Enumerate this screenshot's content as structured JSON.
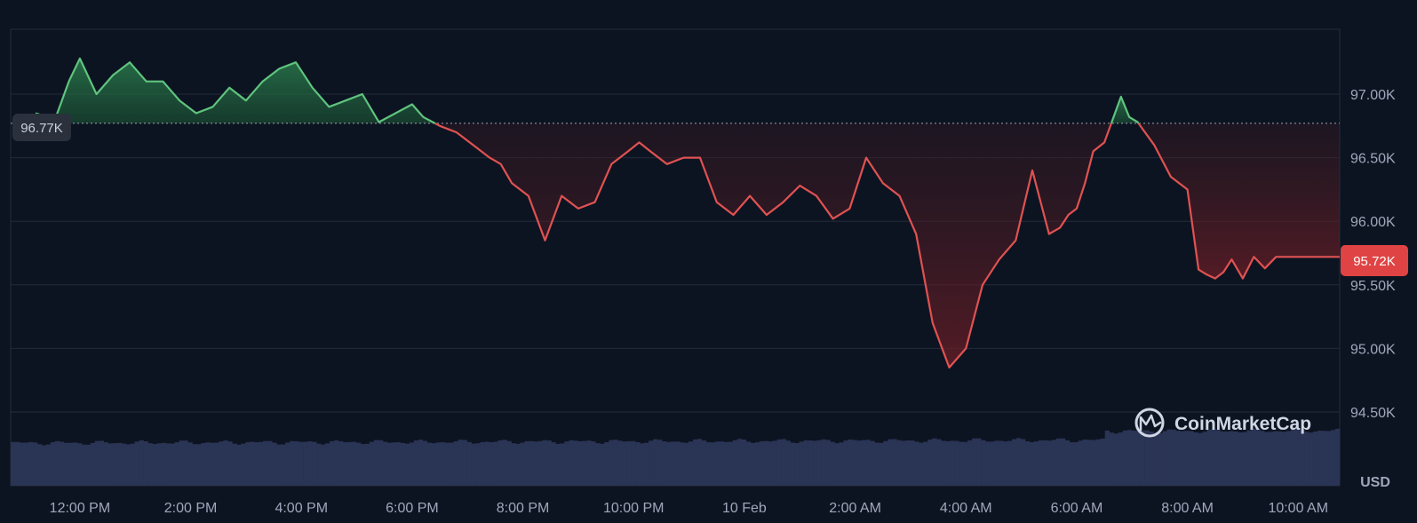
{
  "chart_data": {
    "type": "area",
    "currency_label": "USD",
    "reference_label": "96.77K",
    "reference_value": 96.77,
    "current_label": "95.72K",
    "current_value": 95.72,
    "ylim": [
      94.0,
      97.5
    ],
    "y_ticks": [
      {
        "value": 97.0,
        "label": "97.00K"
      },
      {
        "value": 96.5,
        "label": "96.50K"
      },
      {
        "value": 96.0,
        "label": "96.00K"
      },
      {
        "value": 95.5,
        "label": "95.50K"
      },
      {
        "value": 95.0,
        "label": "95.00K"
      },
      {
        "value": 94.5,
        "label": "94.50K"
      }
    ],
    "x_range": [
      10.75,
      34.75
    ],
    "x_ticks": [
      {
        "value": 12,
        "label": "12:00 PM"
      },
      {
        "value": 14,
        "label": "2:00 PM"
      },
      {
        "value": 16,
        "label": "4:00 PM"
      },
      {
        "value": 18,
        "label": "6:00 PM"
      },
      {
        "value": 20,
        "label": "8:00 PM"
      },
      {
        "value": 22,
        "label": "10:00 PM"
      },
      {
        "value": 24,
        "label": "10 Feb"
      },
      {
        "value": 26,
        "label": "2:00 AM"
      },
      {
        "value": 28,
        "label": "4:00 AM"
      },
      {
        "value": 30,
        "label": "6:00 AM"
      },
      {
        "value": 32,
        "label": "8:00 AM"
      },
      {
        "value": 34,
        "label": "10:00 AM"
      }
    ],
    "colors": {
      "up": "#16c784",
      "down": "#ea3943",
      "line_up": "#5fc47e",
      "line_down": "#e05252",
      "volume": "#2a3455"
    },
    "series": [
      {
        "x": [
          11.2,
          11.55,
          11.8,
          12.0,
          12.3,
          12.6,
          12.9,
          13.2,
          13.5,
          13.8,
          14.1,
          14.4,
          14.7,
          15.0,
          15.3,
          15.6,
          15.9,
          16.2,
          16.5,
          16.8,
          17.1,
          17.4,
          17.7,
          18.0,
          18.2,
          18.5,
          18.8,
          19.1,
          19.4,
          19.6,
          19.8,
          20.1,
          20.4,
          20.7,
          21.0,
          21.3,
          21.6,
          21.9,
          22.1,
          22.3,
          22.6,
          22.9,
          23.2,
          23.5,
          23.8,
          24.1,
          24.4,
          24.7,
          25.0,
          25.3,
          25.6,
          25.9,
          26.2,
          26.5,
          26.8,
          27.1,
          27.4,
          27.7,
          28.0,
          28.3,
          28.6,
          28.9,
          29.2,
          29.5,
          29.7,
          29.85,
          30.0,
          30.15,
          30.3,
          30.5,
          30.8,
          30.95,
          31.1,
          31.4,
          31.7,
          32.0,
          32.2,
          32.35,
          32.5,
          32.65,
          32.8,
          33.0,
          33.2,
          33.4,
          33.6,
          33.75,
          33.9,
          34.1,
          34.3,
          34.5,
          34.75
        ],
        "values": [
          96.85,
          96.8,
          97.1,
          97.28,
          97.0,
          97.15,
          97.25,
          97.1,
          97.1,
          96.95,
          96.85,
          96.9,
          97.05,
          96.95,
          97.1,
          97.2,
          97.25,
          97.05,
          96.9,
          96.95,
          97.0,
          96.78,
          96.85,
          96.92,
          96.82,
          96.75,
          96.7,
          96.6,
          96.5,
          96.45,
          96.3,
          96.2,
          95.85,
          96.2,
          96.1,
          96.15,
          96.45,
          96.55,
          96.62,
          96.55,
          96.45,
          96.5,
          96.5,
          96.15,
          96.05,
          96.2,
          96.05,
          96.15,
          96.28,
          96.2,
          96.02,
          96.1,
          96.5,
          96.3,
          96.2,
          95.9,
          95.2,
          94.85,
          95.0,
          95.5,
          95.7,
          95.85,
          96.4,
          95.9,
          95.95,
          96.05,
          96.1,
          96.3,
          96.55,
          96.62,
          96.98,
          96.82,
          96.78,
          96.6,
          96.35,
          96.25,
          95.62,
          95.58,
          95.55,
          95.6,
          95.7,
          95.55,
          95.72,
          95.63,
          95.72,
          95.72,
          95.72,
          95.72,
          95.72,
          95.72,
          95.72
        ]
      }
    ],
    "watermark": "CoinMarketCap"
  }
}
